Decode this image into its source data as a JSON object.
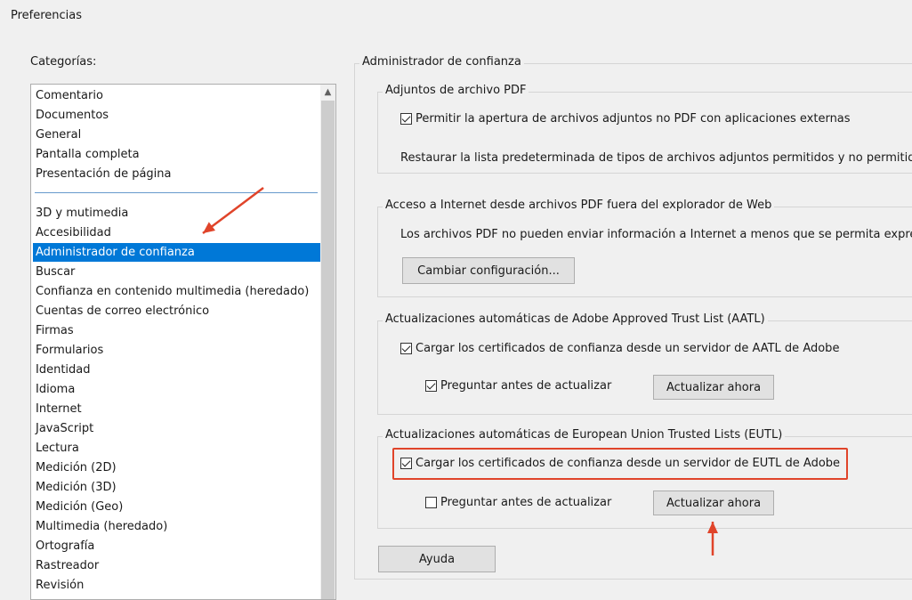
{
  "window": {
    "title": "Preferencias"
  },
  "categories": {
    "label": "Categorías:",
    "top_items": [
      "Comentario",
      "Documentos",
      "General",
      "Pantalla completa",
      "Presentación de página"
    ],
    "items": [
      "3D y mutimedia",
      "Accesibilidad",
      "Administrador de confianza",
      "Buscar",
      "Confianza en contenido multimedia (heredado)",
      "Cuentas de correo electrónico",
      "Firmas",
      "Formularios",
      "Identidad",
      "Idioma",
      "Internet",
      "JavaScript",
      "Lectura",
      "Medición (2D)",
      "Medición (3D)",
      "Medición (Geo)",
      "Multimedia (heredado)",
      "Ortografía",
      "Rastreador",
      "Revisión"
    ],
    "selected": "Administrador de confianza"
  },
  "panel": {
    "title": "Administrador de confianza",
    "pdf_attachments": {
      "title": "Adjuntos de archivo PDF",
      "allow_label": "Permitir la apertura de archivos adjuntos no PDF con aplicaciones externas",
      "allow_checked": true,
      "restore_text": "Restaurar la lista predeterminada de tipos de archivos adjuntos permitidos y no permitido"
    },
    "internet_access": {
      "title": "Acceso a Internet desde archivos PDF fuera del explorador de Web",
      "text": "Los archivos PDF no pueden enviar información a Internet a menos que se permita expre",
      "button": "Cambiar configuración..."
    },
    "aatl": {
      "title": "Actualizaciones automáticas de Adobe Approved Trust List (AATL)",
      "load_label": "Cargar los certificados de confianza desde un servidor de AATL de Adobe",
      "load_checked": true,
      "ask_label": "Preguntar antes de actualizar",
      "ask_checked": true,
      "update_button": "Actualizar ahora"
    },
    "eutl": {
      "title": "Actualizaciones automáticas de European Union Trusted Lists (EUTL)",
      "load_label": "Cargar los certificados de confianza desde un servidor de EUTL de Adobe",
      "load_checked": true,
      "ask_label": "Preguntar antes de actualizar",
      "ask_checked": false,
      "update_button": "Actualizar ahora"
    },
    "help_button": "Ayuda"
  },
  "annotations": {
    "color": "#e0442a"
  }
}
